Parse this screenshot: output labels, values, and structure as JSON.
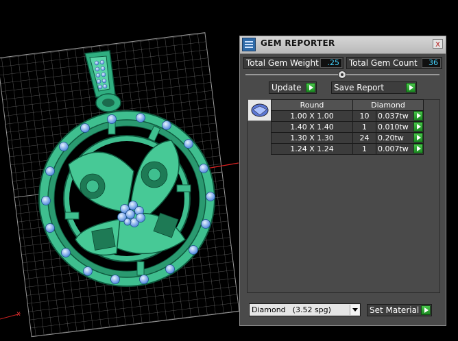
{
  "panel": {
    "title": "GEM REPORTER",
    "close_label": "x",
    "total_gem_weight": {
      "label": "Total Gem Weight",
      "value": ".25"
    },
    "total_gem_count": {
      "label": "Total Gem Count",
      "value": "36"
    },
    "update_label": "Update",
    "save_report_label": "Save Report",
    "table": {
      "headers": [
        "Round",
        "Diamond"
      ],
      "rows": [
        {
          "size": "1.00 X 1.00",
          "count": "10",
          "weight": "0.037tw"
        },
        {
          "size": "1.40 X 1.40",
          "count": "1",
          "weight": "0.010tw"
        },
        {
          "size": "1.30 X 1.30",
          "count": "24",
          "weight": "0.20tw"
        },
        {
          "size": "1.24 X 1.24",
          "count": "1",
          "weight": "0.007tw"
        }
      ]
    },
    "material": {
      "name": "Diamond",
      "spg": "(3.52 spg)"
    },
    "set_material_label": "Set Material"
  },
  "viewport": {
    "axis_label": "x"
  },
  "colors": {
    "model": "#3fbf8f",
    "grid": "#7a7a7a",
    "accent": "#45d5ff",
    "go_button": "#2ea62f"
  }
}
